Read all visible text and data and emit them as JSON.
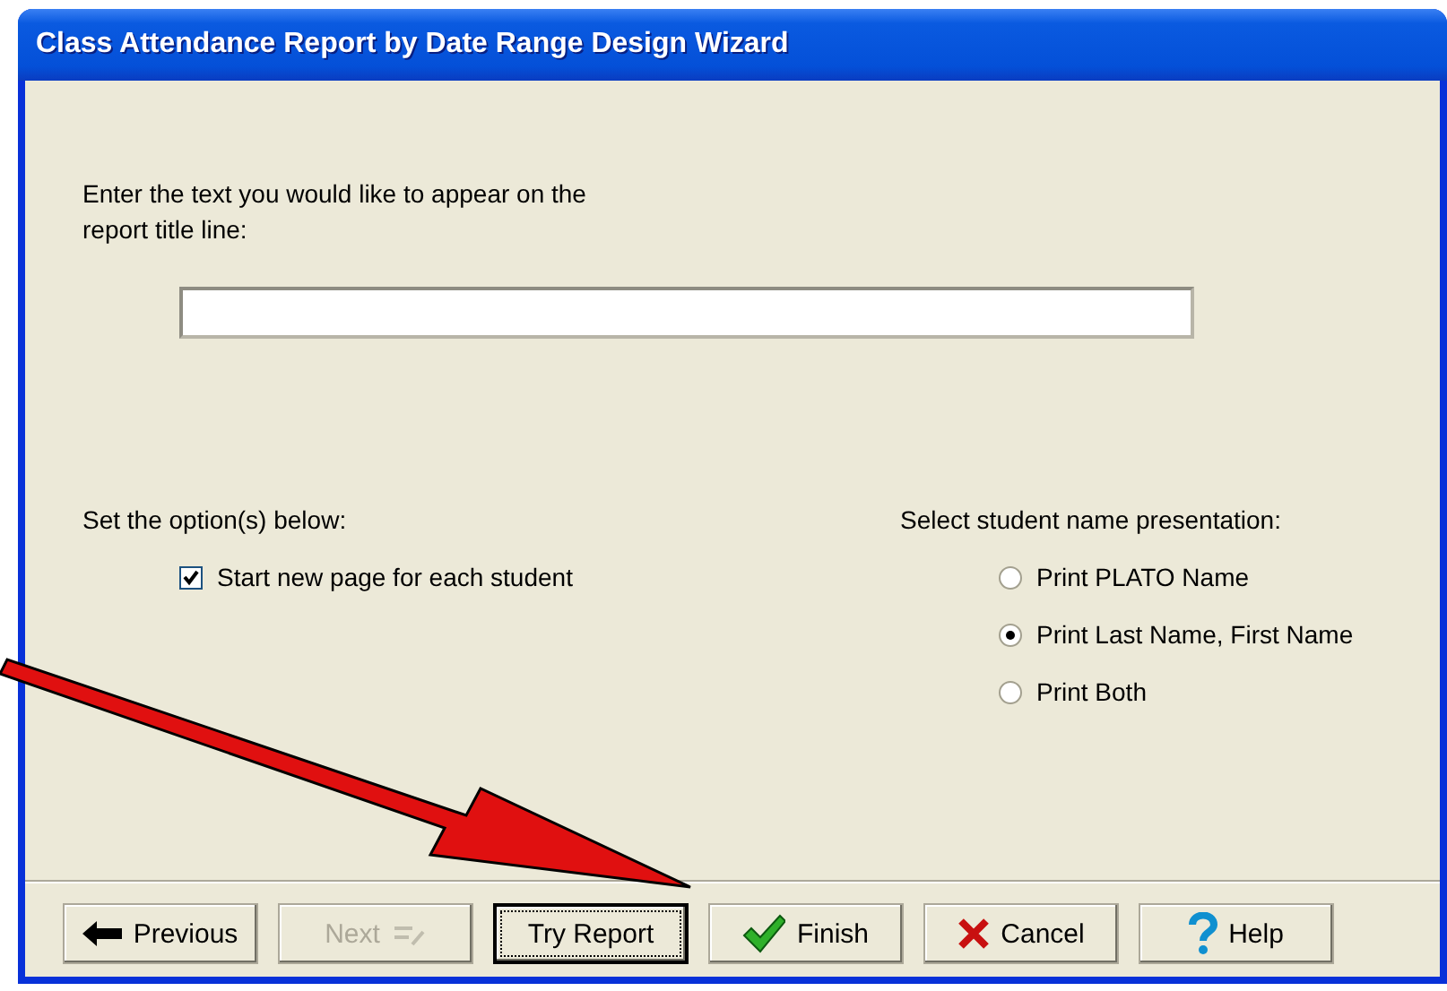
{
  "window": {
    "title": "Class Attendance Report by Date Range Design Wizard"
  },
  "title_prompt": "Enter the text you would like to appear on the report title line:",
  "options": {
    "label": "Set the option(s) below:",
    "items": [
      {
        "label": "Start new page for each student",
        "checked": true
      }
    ]
  },
  "name_presentation": {
    "label": "Select student name presentation:",
    "items": [
      {
        "label": "Print PLATO Name",
        "selected": false
      },
      {
        "label": "Print Last Name, First Name",
        "selected": true
      },
      {
        "label": "Print Both",
        "selected": false
      }
    ]
  },
  "buttons": [
    {
      "label": "Previous",
      "kind": "previous",
      "disabled": false,
      "default": false
    },
    {
      "label": "Next",
      "kind": "next",
      "disabled": true,
      "default": false
    },
    {
      "label": "Try Report",
      "kind": "plain",
      "disabled": false,
      "default": true
    },
    {
      "label": "Finish",
      "kind": "finish",
      "disabled": false,
      "default": false
    },
    {
      "label": "Cancel",
      "kind": "cancel",
      "disabled": false,
      "default": false
    },
    {
      "label": "Help",
      "kind": "help",
      "disabled": false,
      "default": false
    }
  ]
}
